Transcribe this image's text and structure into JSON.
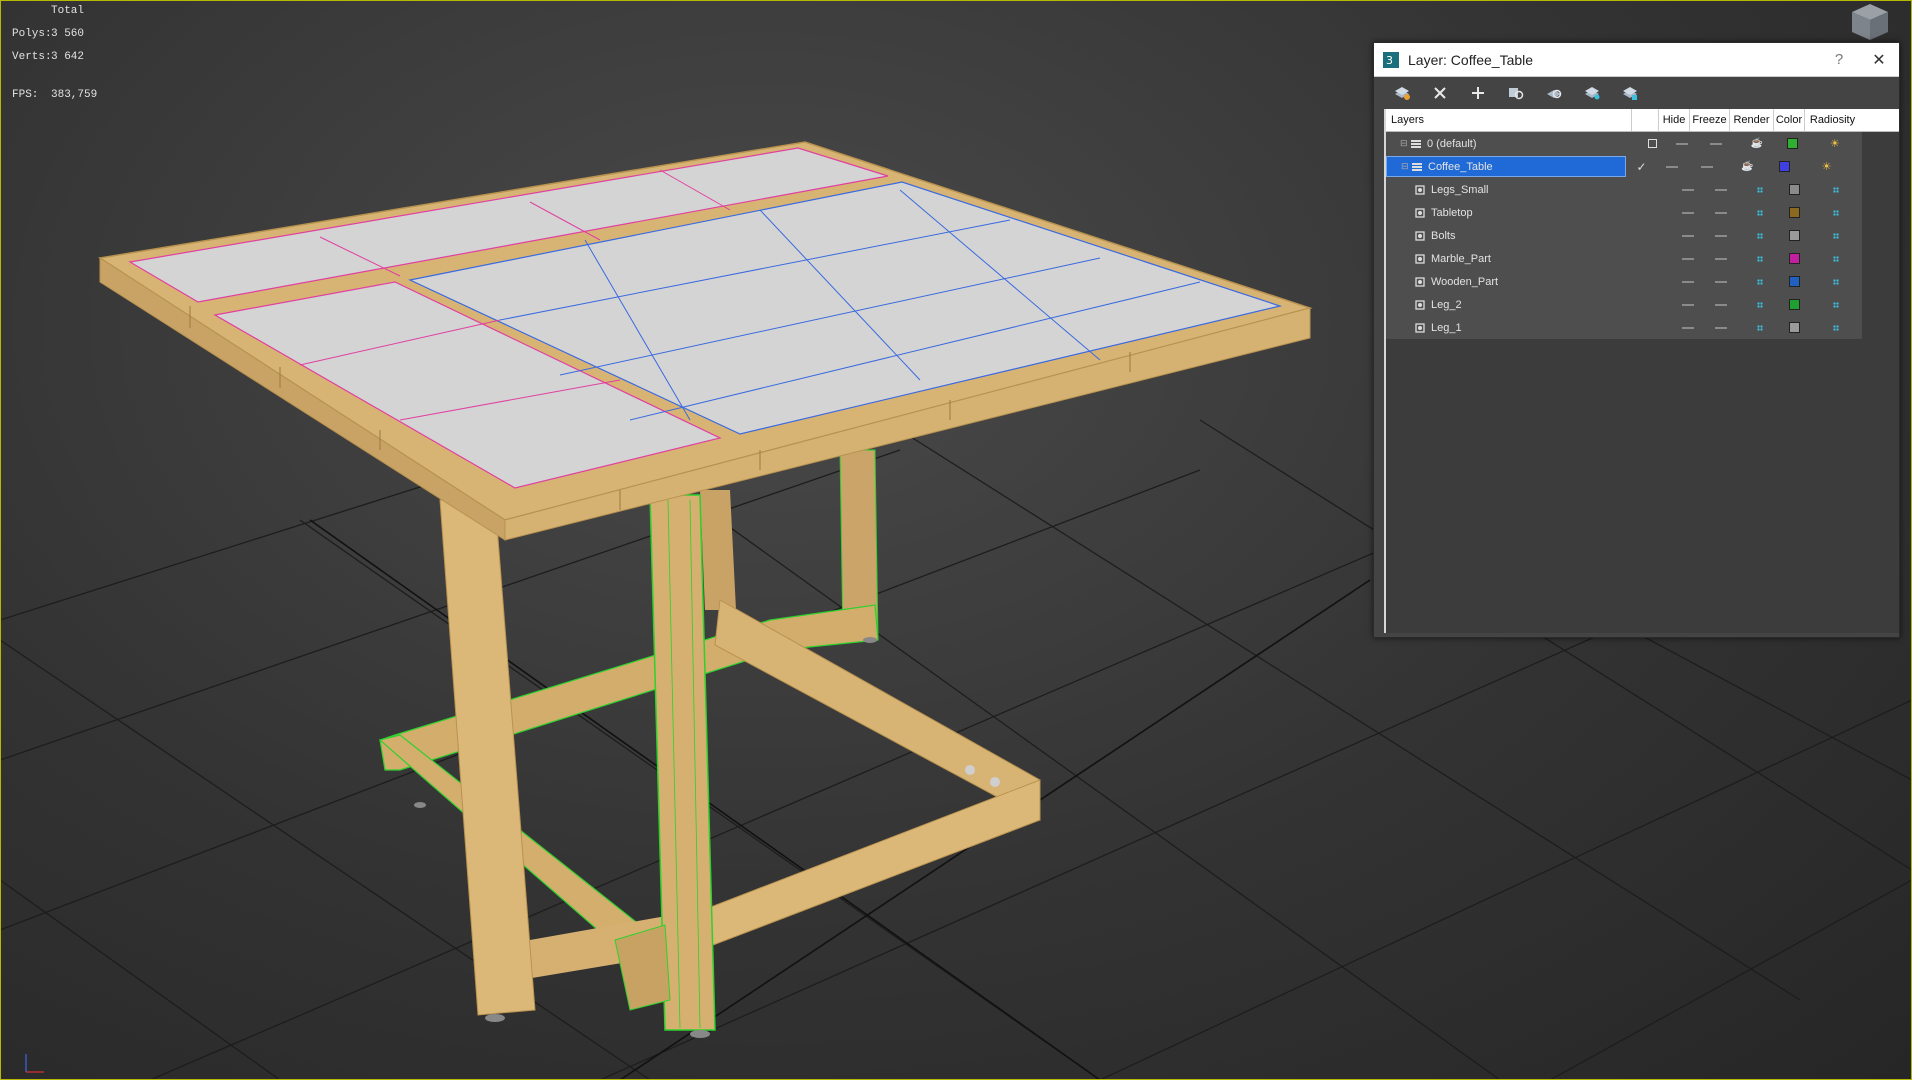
{
  "stats": {
    "total_label": "Total",
    "polys_label": "Polys:",
    "polys_value": "3 560",
    "verts_label": "Verts:",
    "verts_value": "3 642",
    "fps_label": "FPS:",
    "fps_value": "383,759"
  },
  "dialog": {
    "title": "Layer: Coffee_Table",
    "help": "?",
    "close": "✕",
    "toolbar": [
      "create-layer-icon",
      "delete-layer-icon",
      "add-to-layer-icon",
      "select-in-layer-icon",
      "highlight-selected-icon",
      "hide-all-icon",
      "freeze-all-icon"
    ],
    "columns": {
      "layers": "Layers",
      "hide": "Hide",
      "freeze": "Freeze",
      "render": "Render",
      "color": "Color",
      "radiosity": "Radiosity"
    },
    "rows": [
      {
        "name": "0 (default)",
        "level": 0,
        "selected": false,
        "active": "checkbox",
        "color": "#30b030",
        "light": "on"
      },
      {
        "name": "Coffee_Table",
        "level": 0,
        "selected": true,
        "active": "check",
        "color": "#4040e0",
        "light": "on"
      },
      {
        "name": "Legs_Small",
        "level": 1,
        "selected": false,
        "active": "",
        "color": "#8a8a8a",
        "light": "dots"
      },
      {
        "name": "Tabletop",
        "level": 1,
        "selected": false,
        "active": "",
        "color": "#8a6a20",
        "light": "dots"
      },
      {
        "name": "Bolts",
        "level": 1,
        "selected": false,
        "active": "",
        "color": "#9a9a9a",
        "light": "dots"
      },
      {
        "name": "Marble_Part",
        "level": 1,
        "selected": false,
        "active": "",
        "color": "#c020a0",
        "light": "dots"
      },
      {
        "name": "Wooden_Part",
        "level": 1,
        "selected": false,
        "active": "",
        "color": "#2060c0",
        "light": "dots"
      },
      {
        "name": "Leg_2",
        "level": 1,
        "selected": false,
        "active": "",
        "color": "#20a030",
        "light": "dots"
      },
      {
        "name": "Leg_1",
        "level": 1,
        "selected": false,
        "active": "",
        "color": "#9a9a9a",
        "light": "dots"
      }
    ]
  },
  "colors": {
    "wood": "#d8b474",
    "wood_dark": "#b8924f",
    "marble": "#d4d4d4",
    "wire_green": "#2cd12c",
    "wire_pink": "#e040a0",
    "wire_blue": "#3a6ae0",
    "selection": "#1f6ad6"
  }
}
